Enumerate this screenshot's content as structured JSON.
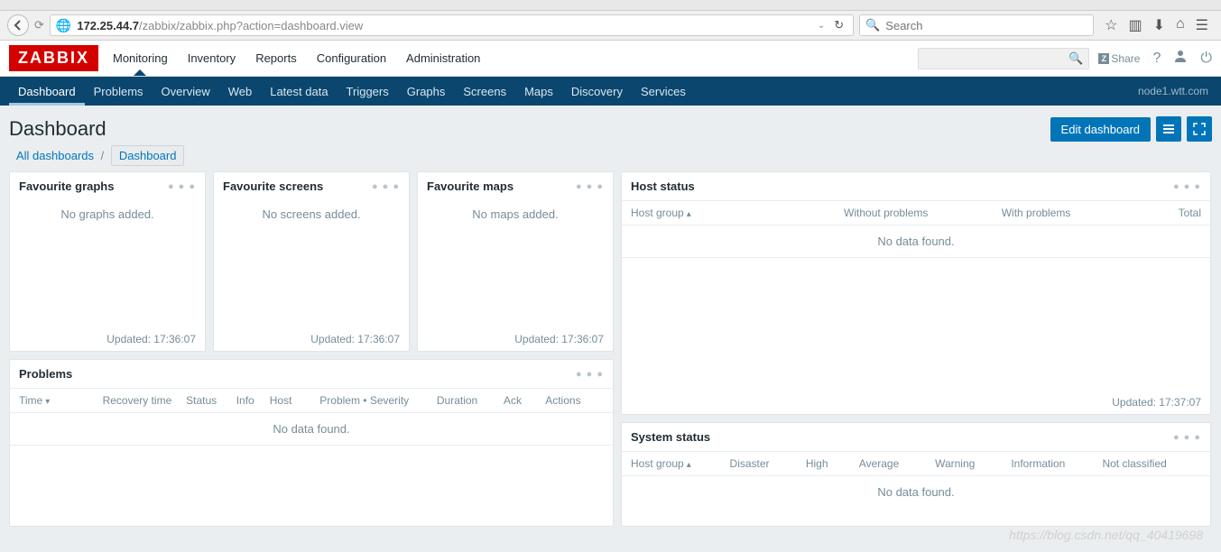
{
  "browser": {
    "url_host": "172.25.44.7",
    "url_path": "/zabbix/zabbix.php?action=dashboard.view",
    "search_placeholder": "Search"
  },
  "header": {
    "logo": "ZABBIX",
    "menu": [
      "Monitoring",
      "Inventory",
      "Reports",
      "Configuration",
      "Administration"
    ],
    "share": "Share"
  },
  "submenu": {
    "items": [
      "Dashboard",
      "Problems",
      "Overview",
      "Web",
      "Latest data",
      "Triggers",
      "Graphs",
      "Screens",
      "Maps",
      "Discovery",
      "Services"
    ],
    "node": "node1.wtt.com"
  },
  "page": {
    "title": "Dashboard",
    "edit_btn": "Edit dashboard",
    "breadcrumbs": {
      "root": "All dashboards",
      "current": "Dashboard"
    }
  },
  "widgets": {
    "fav_graphs": {
      "title": "Favourite graphs",
      "empty": "No graphs added.",
      "updated": "Updated: 17:36:07"
    },
    "fav_screens": {
      "title": "Favourite screens",
      "empty": "No screens added.",
      "updated": "Updated: 17:36:07"
    },
    "fav_maps": {
      "title": "Favourite maps",
      "empty": "No maps added.",
      "updated": "Updated: 17:36:07"
    },
    "problems": {
      "title": "Problems",
      "cols": [
        "Time",
        "Recovery time",
        "Status",
        "Info",
        "Host",
        "Problem • Severity",
        "Duration",
        "Ack",
        "Actions"
      ],
      "no_data": "No data found."
    },
    "host_status": {
      "title": "Host status",
      "cols": [
        "Host group",
        "Without problems",
        "With problems",
        "Total"
      ],
      "no_data": "No data found.",
      "updated": "Updated: 17:37:07"
    },
    "system_status": {
      "title": "System status",
      "cols": [
        "Host group",
        "Disaster",
        "High",
        "Average",
        "Warning",
        "Information",
        "Not classified"
      ],
      "no_data": "No data found."
    }
  },
  "watermark": "https://blog.csdn.net/qq_40419698"
}
